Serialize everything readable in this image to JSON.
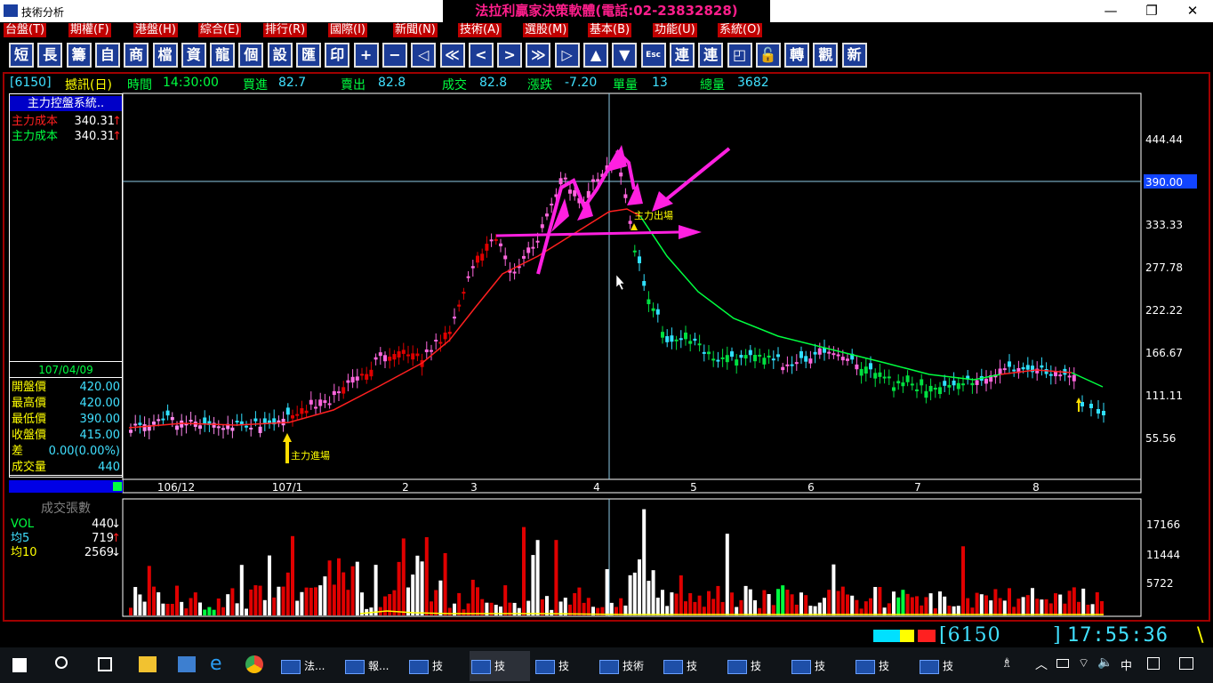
{
  "window": {
    "title": "技術分析",
    "banner": "法拉利贏家決策軟體(電話:02-23832828)",
    "minimize": "—",
    "restore": "❐",
    "close": "✕"
  },
  "menu": [
    "台盤(T)",
    "期權(F)",
    "港盤(H)",
    "綜合(E)",
    "排行(R)",
    "國際(I)",
    "新聞(N)",
    "技術(A)",
    "選股(M)",
    "基本(B)",
    "功能(U)",
    "系統(O)"
  ],
  "toolbar": [
    "短",
    "長",
    "籌",
    "自",
    "商",
    "檔",
    "資",
    "龍",
    "個",
    "設",
    "匯",
    "印",
    "+",
    "−",
    "◁",
    "≪",
    "<",
    ">",
    "≫",
    "▷",
    "▲",
    "▼",
    "Esc",
    "連",
    "連",
    "◰",
    "🔓",
    "轉",
    "觀",
    "新"
  ],
  "info": {
    "code": "[6150]",
    "name": "撼訊(日)",
    "time_label": "時間",
    "time": "14:30:00",
    "bid_label": "買進",
    "bid": "82.7",
    "ask_label": "賣出",
    "ask": "82.8",
    "deal_label": "成交",
    "deal": "82.8",
    "change_label": "漲跌",
    "change": "-7.20",
    "vol_label": "單量",
    "vol": "13",
    "total_label": "總量",
    "total": "3682"
  },
  "left_panel": {
    "system": "主力控盤系統..",
    "rows": [
      {
        "label": "主力成本",
        "value": "340.31",
        "arrow": "↑",
        "color": "#ff2020"
      },
      {
        "label": "主力成本",
        "value": "340.31",
        "arrow": "↑",
        "color": "#00ff40"
      }
    ]
  },
  "ohlc": {
    "date": "107/04/09",
    "rows": [
      {
        "label": "開盤價",
        "value": "420.00"
      },
      {
        "label": "最高價",
        "value": "420.00"
      },
      {
        "label": "最低價",
        "value": "390.00"
      },
      {
        "label": "收盤價",
        "value": "415.00"
      },
      {
        "label": "差",
        "value": "0.00(0.00%)"
      },
      {
        "label": "成交量",
        "value": "440"
      }
    ]
  },
  "price_axis": {
    "ticks": [
      "444.44",
      "390.00",
      "333.33",
      "277.78",
      "222.22",
      "166.67",
      "111.11",
      "55.56"
    ],
    "highlight": "390.00"
  },
  "time_axis": [
    "106/12",
    "107/1",
    "2",
    "3",
    "4",
    "5",
    "6",
    "7",
    "8"
  ],
  "annotations": {
    "exit": "主力出場",
    "entry": "主力進場"
  },
  "volume_panel": {
    "title": "成交張數",
    "rows": [
      {
        "label": "VOL",
        "value": "440",
        "arrow": "↓",
        "color": "#00ff40"
      },
      {
        "label": "均5",
        "value": "719",
        "arrow": "↑",
        "color": "#40e0ff"
      },
      {
        "label": "均10",
        "value": "2569",
        "arrow": "↓",
        "color": "#ffff00"
      }
    ],
    "ticks": [
      "17166",
      "11444",
      "5722"
    ]
  },
  "status": {
    "code": "[6150",
    "close": "]",
    "clock": "17:55:36",
    "spinner": "\\"
  },
  "taskbar": {
    "items": [
      "法...",
      "報...",
      "技",
      "技",
      "技",
      "技術",
      "技",
      "技",
      "技",
      "技",
      "技"
    ],
    "lang": "中"
  },
  "colors": {
    "up": "#e00000",
    "down": "#00e040",
    "up_pink": "#ff66dd",
    "down_cyan": "#30e0ff",
    "arrow": "#ff20e0",
    "ma_red": "#ff2020",
    "ma_green": "#00ff40"
  }
}
